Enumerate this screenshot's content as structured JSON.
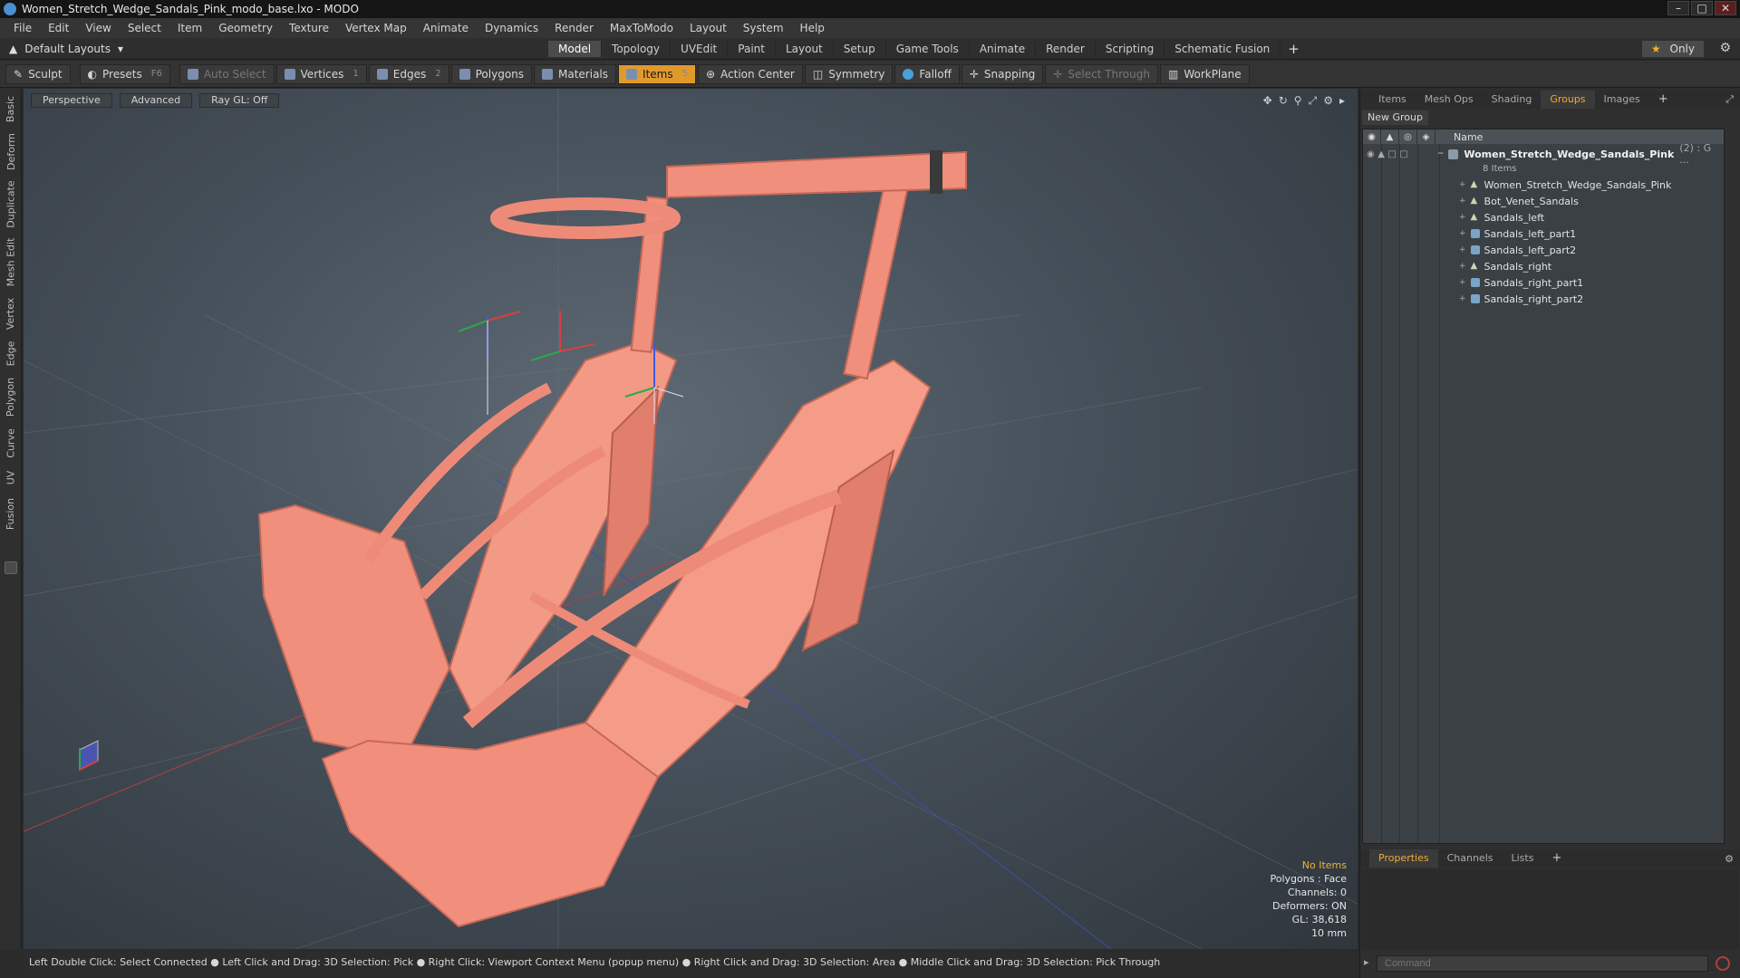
{
  "window": {
    "title": "Women_Stretch_Wedge_Sandals_Pink_modo_base.lxo - MODO",
    "controls": [
      "–",
      "□",
      "✕"
    ]
  },
  "menu": [
    "File",
    "Edit",
    "View",
    "Select",
    "Item",
    "Geometry",
    "Texture",
    "Vertex Map",
    "Animate",
    "Dynamics",
    "Render",
    "MaxToModo",
    "Layout",
    "System",
    "Help"
  ],
  "layoutbar": {
    "layout_dropdown": "Default Layouts",
    "tabs": [
      "Model",
      "Topology",
      "UVEdit",
      "Paint",
      "Layout",
      "Setup",
      "Game Tools",
      "Animate",
      "Render",
      "Scripting",
      "Schematic Fusion"
    ],
    "active_tab": "Model",
    "plus": "+",
    "only_label": "Only"
  },
  "toolbar": {
    "sculpt": "Sculpt",
    "presets": "Presets",
    "presets_key": "F6",
    "auto_select": "Auto Select",
    "vertices": "Vertices",
    "vertices_key": "1",
    "edges": "Edges",
    "edges_key": "2",
    "polygons": "Polygons",
    "materials": "Materials",
    "items": "Items",
    "items_key": "5",
    "action_center": "Action Center",
    "symmetry": "Symmetry",
    "falloff": "Falloff",
    "snapping": "Snapping",
    "select_through": "Select Through",
    "workplane": "WorkPlane"
  },
  "left_tabs": [
    "Basic",
    "Deform",
    "Duplicate",
    "Mesh Edit",
    "Vertex",
    "Edge",
    "Polygon",
    "Curve",
    "UV",
    "Fusion"
  ],
  "viewport": {
    "view_mode": "Perspective",
    "advanced": "Advanced",
    "ray_gl": "Ray GL: Off",
    "stats": {
      "selection": "No Items",
      "polygons": "Polygons : Face",
      "channels": "Channels: 0",
      "deformers": "Deformers: ON",
      "gl": "GL: 38,618",
      "unit": "10 mm"
    }
  },
  "status_bar": "Left Double Click: Select Connected ● Left Click and Drag: 3D Selection: Pick ● Right Click: Viewport Context Menu (popup menu) ● Right Click and Drag: 3D Selection: Area ● Middle Click and Drag: 3D Selection: Pick Through",
  "right_panel": {
    "top_tabs": [
      "Items",
      "Mesh Ops",
      "Shading",
      "Groups",
      "Images"
    ],
    "active_top_tab": "Groups",
    "new_group": "New Group",
    "column_name": "Name",
    "group": {
      "name": "Women_Stretch_Wedge_Sandals_Pink",
      "count": "(2) : G ...",
      "sub": "8 Items"
    },
    "items": [
      {
        "label": "Women_Stretch_Wedge_Sandals_Pink",
        "icon": "locator-icon"
      },
      {
        "label": "Bot_Venet_Sandals",
        "icon": "locator-icon"
      },
      {
        "label": "Sandals_left",
        "icon": "locator-icon"
      },
      {
        "label": "Sandals_left_part1",
        "icon": "mesh-icon"
      },
      {
        "label": "Sandals_left_part2",
        "icon": "mesh-icon"
      },
      {
        "label": "Sandals_right",
        "icon": "locator-icon"
      },
      {
        "label": "Sandals_right_part1",
        "icon": "mesh-icon"
      },
      {
        "label": "Sandals_right_part2",
        "icon": "mesh-icon"
      }
    ],
    "bottom_tabs": [
      "Properties",
      "Channels",
      "Lists"
    ],
    "active_bottom_tab": "Properties",
    "command_placeholder": "Command"
  },
  "colors": {
    "accent": "#f0a83a",
    "active_tool": "#e09a2c",
    "sandal": "#f28f7e"
  }
}
